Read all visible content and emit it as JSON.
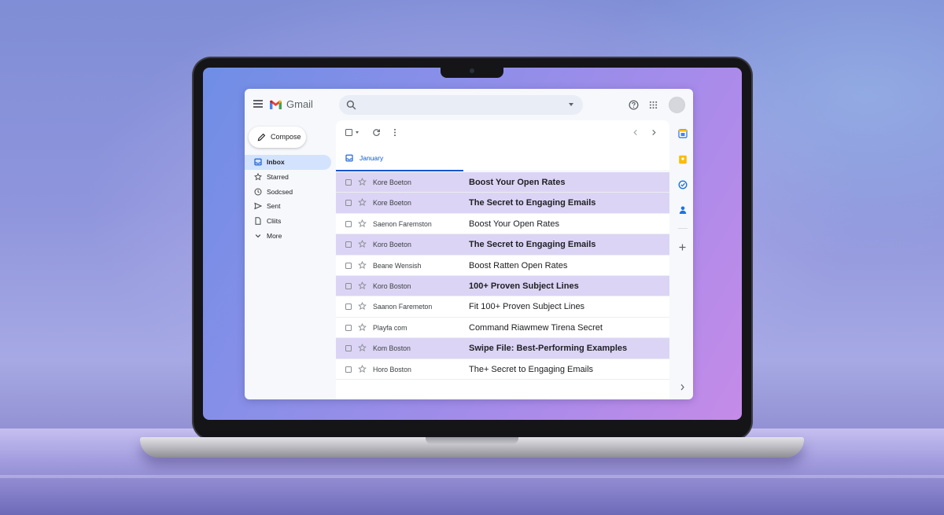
{
  "app": {
    "name": "Gmail"
  },
  "search": {
    "placeholder": ""
  },
  "sidebar": {
    "compose_label": "Compose",
    "items": [
      {
        "label": "Inbox",
        "icon": "inbox-icon",
        "active": true
      },
      {
        "label": "Starred",
        "icon": "star-icon",
        "active": false
      },
      {
        "label": "Sodcsed",
        "icon": "clock-icon",
        "active": false
      },
      {
        "label": "Sent",
        "icon": "send-icon",
        "active": false
      },
      {
        "label": "Cliits",
        "icon": "draft-icon",
        "active": false
      },
      {
        "label": "More",
        "icon": "chevron-down-icon",
        "active": false
      }
    ]
  },
  "tabs": [
    {
      "label": "January",
      "icon": "inbox-icon",
      "active": true
    }
  ],
  "emails": [
    {
      "sender": "Kore Boeton",
      "subject": "Boost Your Open Rates",
      "highlighted": true
    },
    {
      "sender": "Kore Boeton",
      "subject": "The Secret to Engaging Emails",
      "highlighted": true
    },
    {
      "sender": "Saenon Faremston",
      "subject": "Boost Your Open Rates",
      "highlighted": false
    },
    {
      "sender": "Koro Boeton",
      "subject": "The Secret to Engaging Emails",
      "highlighted": true
    },
    {
      "sender": "Beane Wensish",
      "subject": "Boost Ratten Open Rates",
      "highlighted": false
    },
    {
      "sender": "Koro Boston",
      "subject": "100+ Proven Subject Lines",
      "highlighted": true
    },
    {
      "sender": "Saanon Faremeton",
      "subject": "Fit 100+ Proven Subject Lines",
      "highlighted": false
    },
    {
      "sender": "Playfa com",
      "subject": "Command Riawmew Tirena Secret",
      "highlighted": false
    },
    {
      "sender": "Kom Boston",
      "subject": "Swipe File: Best-Performing Examples",
      "highlighted": true
    },
    {
      "sender": "Horo Boston",
      "subject": "The+ Secret to Engaging Emails",
      "highlighted": false
    }
  ],
  "side_panel": [
    {
      "icon": "calendar-icon",
      "color": "#1a73e8"
    },
    {
      "icon": "keep-icon",
      "color": "#fbbc04"
    },
    {
      "icon": "tasks-icon",
      "color": "#1a73e8"
    },
    {
      "icon": "contacts-icon",
      "color": "#1a73e8"
    }
  ],
  "colors": {
    "highlight_row": "#dcd4f5",
    "accent": "#0b57d0",
    "active_nav": "#d3e3fd"
  }
}
